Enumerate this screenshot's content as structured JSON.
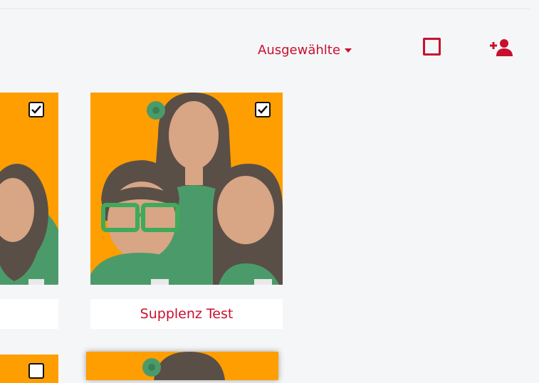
{
  "toolbar": {
    "dropdown_label": "Ausgewählte",
    "select_all_icon": "checkbox-empty-icon",
    "add_user_icon": "user-plus-icon",
    "accent_color": "#c8102e"
  },
  "cards": [
    {
      "name": "",
      "selected": true,
      "avatar_icon": "group-avatar-icon"
    },
    {
      "name": "Supplenz Test",
      "selected": true,
      "avatar_icon": "group-avatar-icon"
    },
    {
      "name": "",
      "selected": true,
      "avatar_icon": "group-avatar-icon"
    },
    {
      "name": "",
      "selected": false,
      "avatar_icon": "group-avatar-icon"
    }
  ],
  "colors": {
    "photo_bg": "#ff9e00",
    "page_bg": "#f5f6f8"
  }
}
